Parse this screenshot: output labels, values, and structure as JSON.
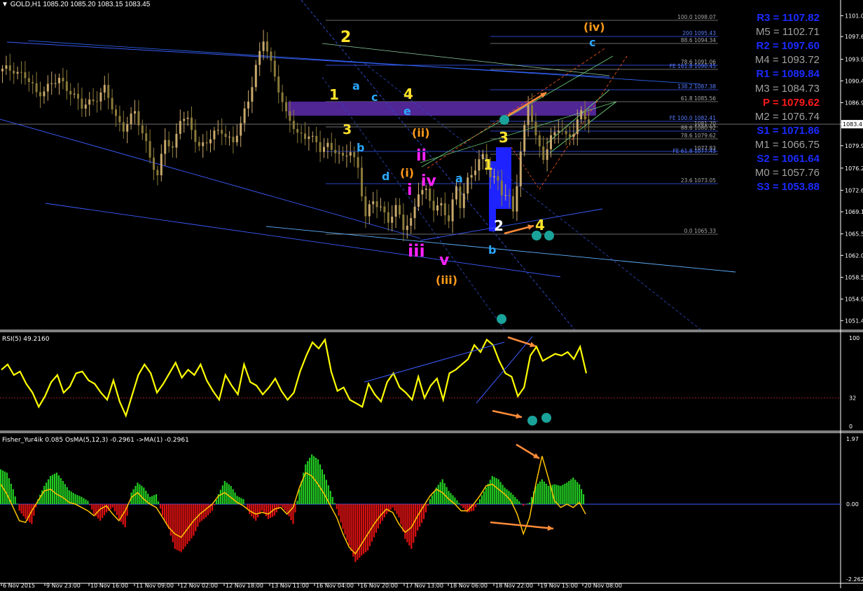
{
  "window": {
    "title": "GOLD,H1",
    "ohlc": "1085.20 1085.20 1083.15 1083.45",
    "last_price": "1083.4"
  },
  "colors": {
    "background": "#000000",
    "grid": "#5a5a5a",
    "up_candle": "#c8a86b",
    "down_candle": "#8a7a3a",
    "rsi": "#ffff00",
    "osma_pos": "#22cc22",
    "osma_neg": "#dd1111",
    "signal": "#ffc400",
    "zone": "#6b2db0",
    "fib": "#7f7f7f",
    "teal": "#1aa39a",
    "arrow": "#ff8c3a"
  },
  "pivots": [
    {
      "label": "R3 = 1107.82",
      "color": "#1b2bff"
    },
    {
      "label": "M5 = 1102.71",
      "color": "#a0a0a0"
    },
    {
      "label": "R2 = 1097.60",
      "color": "#1b2bff"
    },
    {
      "label": "M4 = 1093.72",
      "color": "#a0a0a0"
    },
    {
      "label": "R1 = 1089.84",
      "color": "#1b2bff"
    },
    {
      "label": "M3 = 1084.73",
      "color": "#a0a0a0"
    },
    {
      "label": "P   = 1079.62",
      "color": "#ff1a1a"
    },
    {
      "label": "M2 = 1076.74",
      "color": "#a0a0a0"
    },
    {
      "label": "S1 = 1071.86",
      "color": "#1b2bff"
    },
    {
      "label": "M1 = 1066.75",
      "color": "#a0a0a0"
    },
    {
      "label": "S2 = 1061.64",
      "color": "#1b2bff"
    },
    {
      "label": "M0 = 1057.76",
      "color": "#a0a0a0"
    },
    {
      "label": "S3 = 1053.88",
      "color": "#1b2bff"
    }
  ],
  "fib_levels": [
    "100.0 1098.07",
    "200 1095.43",
    "88.6 1094.34",
    "78.6 1091.06",
    "FE 161.8 1090.45",
    "138.2 1087.38",
    "61.8 1085.56",
    "FE 100.0 1082.41",
    "1081.70",
    "88.6 1080.92",
    "78.6 1079.62",
    "1077.83",
    "FE 61.8 1077.43",
    "23.6 1073.05",
    "0.0 1065.33"
  ],
  "wave_labels": [
    {
      "text": "2",
      "color": "#ffe32a"
    },
    {
      "text": "1",
      "color": "#ffe32a"
    },
    {
      "text": "3",
      "color": "#ffe32a"
    },
    {
      "text": "4",
      "color": "#ffe32a"
    },
    {
      "text": "a",
      "color": "#2aa8ff"
    },
    {
      "text": "c",
      "color": "#2aa8ff"
    },
    {
      "text": "e",
      "color": "#2aa8ff"
    },
    {
      "text": "b",
      "color": "#2aa8ff"
    },
    {
      "text": "d",
      "color": "#2aa8ff"
    },
    {
      "text": "(ii)",
      "color": "#ff9a1a"
    },
    {
      "text": "(i)",
      "color": "#ff9a1a"
    },
    {
      "text": "ii",
      "color": "#ff22ff"
    },
    {
      "text": "i",
      "color": "#ff22ff"
    },
    {
      "text": "iv",
      "color": "#ff22ff"
    },
    {
      "text": "iii",
      "color": "#ff22ff"
    },
    {
      "text": "v",
      "color": "#ff22ff"
    },
    {
      "text": "(iii)",
      "color": "#ff9a1a"
    },
    {
      "text": "a",
      "color": "#2aa8ff"
    },
    {
      "text": "b",
      "color": "#2aa8ff"
    },
    {
      "text": "1",
      "color": "#ffe32a"
    },
    {
      "text": "3",
      "color": "#ffe32a"
    },
    {
      "text": "2",
      "color": "#ffffff"
    },
    {
      "text": "4",
      "color": "#ffe32a"
    },
    {
      "text": "(iv)",
      "color": "#ff9a1a"
    },
    {
      "text": "c",
      "color": "#2aa8ff"
    }
  ],
  "chart_data": [
    {
      "type": "candlestick",
      "title": "GOLD,H1",
      "price_axis_ticks": [
        "1101.05",
        "1097.65",
        "1093.95",
        "1090.45",
        "1086.90",
        "1083.4",
        "1079.90",
        "1076.25",
        "1072.65",
        "1069.15",
        "1065.55",
        "1062.05",
        "1058.50",
        "1054.95",
        "1051.45"
      ],
      "time_axis_ticks": [
        "6 Nov 2015",
        "9 Nov 23:00",
        "10 Nov 16:00",
        "11 Nov 09:00",
        "12 Nov 02:00",
        "12 Nov 18:00",
        "13 Nov 11:00",
        "16 Nov 04:00",
        "16 Nov 20:00",
        "17 Nov 13:00",
        "18 Nov 06:00",
        "18 Nov 22:00",
        "19 Nov 15:00",
        "20 Nov 08:00"
      ],
      "close_path": [
        [
          0,
          1092.0
        ],
        [
          3,
          1092.5
        ],
        [
          6,
          1091.0
        ],
        [
          9,
          1088.5
        ],
        [
          12,
          1089.5
        ],
        [
          15,
          1090.5
        ],
        [
          18,
          1089.0
        ],
        [
          21,
          1086.0
        ],
        [
          24,
          1087.5
        ],
        [
          27,
          1089.0
        ],
        [
          30,
          1084.5
        ],
        [
          32,
          1083.0
        ],
        [
          35,
          1085.0
        ],
        [
          38,
          1080.5
        ],
        [
          41,
          1074.5
        ],
        [
          43,
          1081.0
        ],
        [
          45,
          1079.5
        ],
        [
          47,
          1084.5
        ],
        [
          49,
          1083.5
        ],
        [
          52,
          1080.0
        ],
        [
          55,
          1081.0
        ],
        [
          58,
          1082.5
        ],
        [
          61,
          1080.5
        ],
        [
          63,
          1083.0
        ],
        [
          65,
          1087.5
        ],
        [
          67,
          1093.0
        ],
        [
          69,
          1097.0
        ],
        [
          71,
          1093.0
        ],
        [
          73,
          1089.5
        ],
        [
          75,
          1085.0
        ],
        [
          78,
          1081.5
        ],
        [
          81,
          1082.0
        ],
        [
          84,
          1079.0
        ],
        [
          86,
          1080.0
        ],
        [
          88,
          1079.5
        ],
        [
          90,
          1077.5
        ],
        [
          92,
          1079.0
        ],
        [
          94,
          1076.5
        ],
        [
          96,
          1068.5
        ],
        [
          98,
          1070.5
        ],
        [
          100,
          1070.0
        ],
        [
          102,
          1068.0
        ],
        [
          104,
          1069.5
        ],
        [
          106,
          1066.5
        ],
        [
          108,
          1068.0
        ],
        [
          110,
          1072.5
        ],
        [
          112,
          1072.0
        ],
        [
          114,
          1070.0
        ],
        [
          116,
          1070.5
        ],
        [
          118,
          1067.5
        ],
        [
          120,
          1073.0
        ],
        [
          121,
          1070.5
        ],
        [
          123,
          1074.5
        ],
        [
          125,
          1076.0
        ],
        [
          127,
          1078.0
        ],
        [
          129,
          1075.5
        ],
        [
          131,
          1074.0
        ],
        [
          132,
          1072.0
        ],
        [
          134,
          1071.0
        ],
        [
          135,
          1069.5
        ],
        [
          137,
          1079.0
        ],
        [
          139,
          1086.5
        ],
        [
          141,
          1081.0
        ],
        [
          143,
          1078.5
        ],
        [
          145,
          1081.0
        ],
        [
          147,
          1082.5
        ],
        [
          149,
          1081.5
        ],
        [
          151,
          1082.5
        ],
        [
          153,
          1085.0
        ],
        [
          155,
          1083.5
        ]
      ]
    },
    {
      "type": "line",
      "title": "RSI(5) 49.2160",
      "ylim": [
        0,
        100
      ],
      "ticks": [
        "100",
        "32",
        "0"
      ],
      "series": [
        {
          "name": "RSI(5)",
          "values": [
            64,
            70,
            58,
            62,
            48,
            38,
            22,
            34,
            50,
            58,
            38,
            45,
            60,
            62,
            52,
            48,
            38,
            30,
            52,
            28,
            12,
            35,
            58,
            70,
            60,
            38,
            48,
            60,
            72,
            55,
            64,
            58,
            70,
            52,
            40,
            30,
            58,
            46,
            36,
            70,
            50,
            46,
            36,
            44,
            54,
            40,
            30,
            38,
            62,
            80,
            95,
            88,
            98,
            62,
            40,
            44,
            30,
            26,
            22,
            48,
            36,
            28,
            50,
            60,
            44,
            38,
            30,
            56,
            32,
            46,
            54,
            30,
            60,
            64,
            70,
            76,
            92,
            84,
            98,
            92,
            74,
            60,
            56,
            34,
            44,
            80,
            90,
            74,
            78,
            82,
            80,
            84,
            76,
            90,
            60
          ]
        }
      ]
    },
    {
      "type": "bar",
      "title": "Fisher_Yur4ik 0.085  OsMA(5,12,3) -0.2961  ->MA(1) -0.2961",
      "ylim": [
        -2.262,
        1.97
      ],
      "ticks": [
        "1.97",
        "0.00",
        "-2.262"
      ],
      "series": [
        {
          "name": "OsMA(5,12,3)",
          "values": [
            1.05,
            0.95,
            0.45,
            -0.2,
            -0.45,
            -0.6,
            0.15,
            0.55,
            0.85,
            0.95,
            0.7,
            0.42,
            0.3,
            0.22,
            0.1,
            -0.3,
            -0.5,
            -0.25,
            -0.1,
            -0.45,
            -0.7,
            0.35,
            0.65,
            0.5,
            0.22,
            0.3,
            -0.35,
            -0.75,
            -1.35,
            -1.45,
            -1.2,
            -0.95,
            -0.55,
            -0.4,
            -0.2,
            0.3,
            0.7,
            0.55,
            0.25,
            0.15,
            -0.3,
            -0.5,
            -0.2,
            -0.45,
            -0.35,
            -0.05,
            -0.25,
            -0.6,
            0.45,
            1.2,
            1.5,
            1.35,
            0.9,
            0.4,
            -0.15,
            -0.75,
            -1.25,
            -1.75,
            -1.55,
            -1.4,
            -1.0,
            -0.6,
            -0.3,
            -0.1,
            -0.4,
            -1.05,
            -1.35,
            -0.8,
            -0.45,
            0.15,
            0.5,
            0.75,
            0.4,
            0.2,
            -0.05,
            -0.25,
            -0.2,
            0.15,
            0.5,
            0.85,
            0.75,
            0.5,
            0.35,
            0.15,
            -0.05,
            0.05,
            0.55,
            0.75,
            0.55,
            0.6,
            0.55,
            0.65,
            0.8,
            0.6,
            0.15
          ]
        },
        {
          "name": "MA(1)",
          "values": [
            0.6,
            0.3,
            -0.1,
            -0.5,
            -0.55,
            -0.2,
            0.1,
            0.4,
            0.45,
            0.3,
            0.2,
            0.05,
            0.0,
            -0.1,
            -0.2,
            -0.35,
            -0.15,
            -0.05,
            -0.3,
            -0.5,
            -0.2,
            0.2,
            0.35,
            0.15,
            0.0,
            -0.1,
            -0.4,
            -0.7,
            -0.9,
            -1.0,
            -0.75,
            -0.5,
            -0.3,
            -0.15,
            0.0,
            0.25,
            0.35,
            0.2,
            0.05,
            -0.05,
            -0.2,
            -0.3,
            -0.25,
            -0.3,
            -0.15,
            -0.1,
            -0.3,
            -0.1,
            0.5,
            0.95,
            0.85,
            0.6,
            0.3,
            -0.05,
            -0.4,
            -0.9,
            -1.3,
            -1.5,
            -1.2,
            -0.9,
            -0.6,
            -0.35,
            -0.15,
            -0.25,
            -0.6,
            -0.85,
            -0.7,
            -0.35,
            -0.05,
            0.25,
            0.45,
            0.35,
            0.15,
            0.0,
            -0.2,
            -0.2,
            0.0,
            0.25,
            0.55,
            0.6,
            0.45,
            0.3,
            0.1,
            -0.3,
            -0.9,
            -0.4,
            0.6,
            1.45,
            0.8,
            0.1,
            -0.1,
            0.0,
            -0.1,
            0.05,
            -0.3
          ]
        }
      ]
    }
  ]
}
